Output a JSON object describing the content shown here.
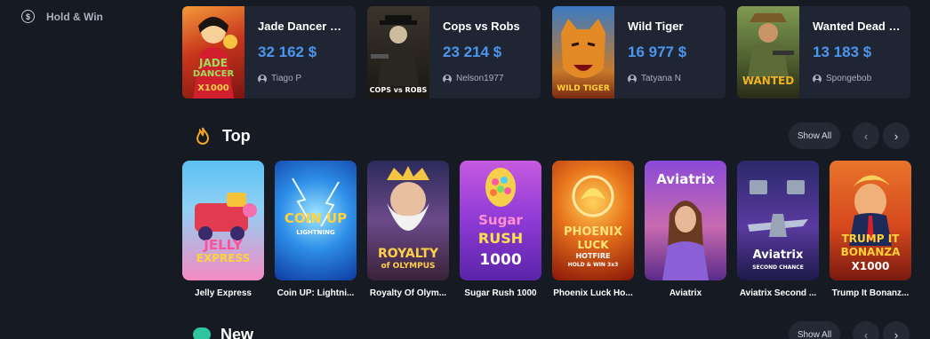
{
  "sidebar": {
    "items": [
      {
        "label": "Hold & Win",
        "icon": "dollar-coin-icon"
      }
    ]
  },
  "winners": [
    {
      "game": "Jade Dancer 10...",
      "amount": "32 162 $",
      "user": "Tiago P",
      "art": [
        "JADE",
        "DANCER",
        "X1000"
      ]
    },
    {
      "game": "Cops vs Robs",
      "amount": "23 214 $",
      "user": "Nelson1977",
      "art": [
        "COPS vs ROBS"
      ]
    },
    {
      "game": "Wild Tiger",
      "amount": "16 977 $",
      "user": "Tatyana N",
      "art": [
        "WILD TIGER"
      ]
    },
    {
      "game": "Wanted Dead o...",
      "amount": "13 183 $",
      "user": "Spongebob",
      "art": [
        "WANTED"
      ]
    }
  ],
  "sections": {
    "top": {
      "title": "Top",
      "show_all": "Show All"
    },
    "new": {
      "title": "New",
      "show_all": "Show All"
    }
  },
  "nav": {
    "prev": "‹",
    "next": "›"
  },
  "top_games": [
    {
      "label": "Jelly Express",
      "art": [
        "JELLY",
        "EXPRESS"
      ]
    },
    {
      "label": "Coin UP: Lightni...",
      "art": [
        "COIN UP",
        "LIGHTNING"
      ]
    },
    {
      "label": "Royalty Of Olym...",
      "art": [
        "ROYALTY",
        "of OLYMPUS"
      ]
    },
    {
      "label": "Sugar Rush 1000",
      "art": [
        "Sugar",
        "RUSH",
        "1000"
      ]
    },
    {
      "label": "Phoenix Luck Ho...",
      "art": [
        "PHOENIX",
        "LUCK",
        "HOTFIRE",
        "HOLD & WIN 3x3"
      ]
    },
    {
      "label": "Aviatrix",
      "art": [
        "Aviatrix"
      ]
    },
    {
      "label": "Aviatrix Second ...",
      "art": [
        "Aviatrix",
        "SECOND CHANCE"
      ]
    },
    {
      "label": "Trump It Bonanz...",
      "art": [
        "TRUMP IT",
        "BONANZA",
        "X1000"
      ]
    }
  ],
  "colors": {
    "background": "#161a22",
    "card": "#1f2532",
    "amount": "#4a96f0",
    "fire_accent": "#f5a623",
    "new_accent": "#2fc4a0"
  }
}
